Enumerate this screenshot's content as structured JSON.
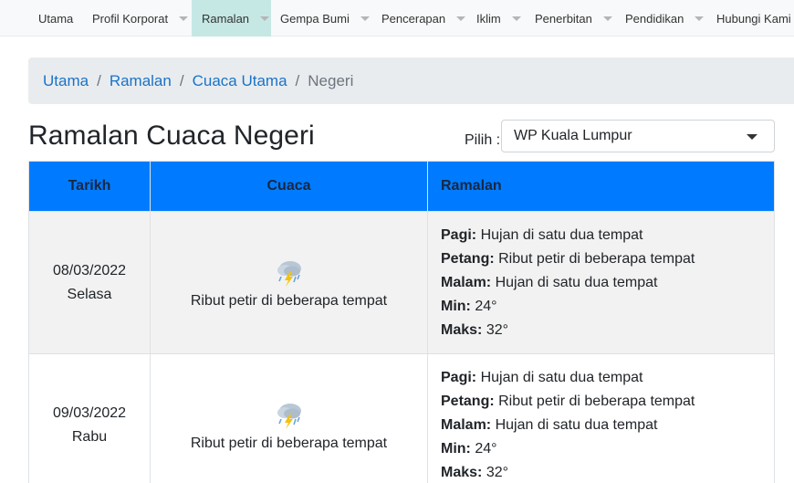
{
  "nav": {
    "items": [
      {
        "label": "Utama",
        "dropdown": false,
        "active": false
      },
      {
        "label": "Profil Korporat",
        "dropdown": true,
        "active": false
      },
      {
        "label": "Ramalan",
        "dropdown": true,
        "active": true
      },
      {
        "label": "Gempa Bumi",
        "dropdown": true,
        "active": false
      },
      {
        "label": "Pencerapan",
        "dropdown": true,
        "active": false
      },
      {
        "label": "Iklim",
        "dropdown": true,
        "active": false
      },
      {
        "label": "Penerbitan",
        "dropdown": true,
        "active": false
      },
      {
        "label": "Pendidikan",
        "dropdown": true,
        "active": false
      },
      {
        "label": "Hubungi Kami",
        "dropdown": false,
        "active": false
      }
    ]
  },
  "breadcrumb": {
    "items": [
      "Utama",
      "Ramalan",
      "Cuaca Utama"
    ],
    "separator": "/",
    "current": "Negeri"
  },
  "page": {
    "title": "Ramalan Cuaca Negeri",
    "select_label": "Pilih :",
    "selected_state": "WP Kuala Lumpur"
  },
  "table": {
    "headers": [
      "Tarikh",
      "Cuaca",
      "Ramalan"
    ],
    "labels": {
      "pagi": "Pagi:",
      "petang": "Petang:",
      "malam": "Malam:",
      "min": "Min:",
      "maks": "Maks:"
    },
    "rows": [
      {
        "date": "08/03/2022",
        "day": "Selasa",
        "weather_icon": "thunderstorm-icon",
        "weather": "Ribut petir di beberapa tempat",
        "pagi": "Hujan di satu dua tempat",
        "petang": "Ribut petir di beberapa tempat",
        "malam": "Hujan di satu dua tempat",
        "min": "24°",
        "maks": "32°"
      },
      {
        "date": "09/03/2022",
        "day": "Rabu",
        "weather_icon": "thunderstorm-icon",
        "weather": "Ribut petir di beberapa tempat",
        "pagi": "Hujan di satu dua tempat",
        "petang": "Ribut petir di beberapa tempat",
        "malam": "Hujan di satu dua tempat",
        "min": "24°",
        "maks": "32°"
      }
    ]
  },
  "colors": {
    "nav_active": "#c5e8e5",
    "table_header": "#007bff",
    "link": "#1a73c8"
  }
}
